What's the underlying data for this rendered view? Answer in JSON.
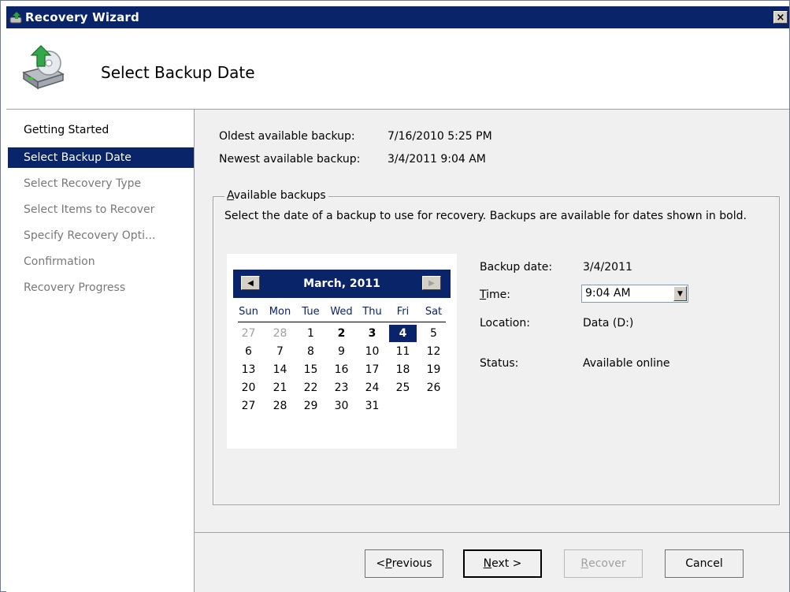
{
  "window": {
    "title": "Recovery Wizard",
    "close_glyph": "×"
  },
  "header": {
    "title": "Select Backup Date",
    "icon": "backup-recovery-icon"
  },
  "sidebar": {
    "items": [
      {
        "label": "Getting Started",
        "state": "done"
      },
      {
        "label": "Select Backup Date",
        "state": "active"
      },
      {
        "label": "Select Recovery Type",
        "state": "pending"
      },
      {
        "label": "Select Items to Recover",
        "state": "pending"
      },
      {
        "label": "Specify Recovery Opti...",
        "state": "pending"
      },
      {
        "label": "Confirmation",
        "state": "pending"
      },
      {
        "label": "Recovery Progress",
        "state": "pending"
      }
    ]
  },
  "summary": {
    "oldest_label": "Oldest available backup:",
    "oldest_value": "7/16/2010 5:25 PM",
    "newest_label": "Newest available backup:",
    "newest_value": "3/4/2011 9:04 AM"
  },
  "group": {
    "legend_accel": "A",
    "legend_rest": "vailable backups",
    "description": "Select the date of a backup to use for recovery. Backups are available for dates shown in bold."
  },
  "calendar": {
    "title": "March, 2011",
    "prev_glyph": "◀",
    "next_glyph": "▶",
    "dow": [
      "Sun",
      "Mon",
      "Tue",
      "Wed",
      "Thu",
      "Fri",
      "Sat"
    ],
    "weeks": [
      [
        {
          "d": "27",
          "other": true
        },
        {
          "d": "28",
          "other": true
        },
        {
          "d": "1"
        },
        {
          "d": "2",
          "bold": true
        },
        {
          "d": "3",
          "bold": true
        },
        {
          "d": "4",
          "sel": true
        },
        {
          "d": "5"
        }
      ],
      [
        {
          "d": "6"
        },
        {
          "d": "7"
        },
        {
          "d": "8"
        },
        {
          "d": "9"
        },
        {
          "d": "10"
        },
        {
          "d": "11"
        },
        {
          "d": "12"
        }
      ],
      [
        {
          "d": "13"
        },
        {
          "d": "14"
        },
        {
          "d": "15"
        },
        {
          "d": "16"
        },
        {
          "d": "17"
        },
        {
          "d": "18"
        },
        {
          "d": "19"
        }
      ],
      [
        {
          "d": "20"
        },
        {
          "d": "21"
        },
        {
          "d": "22"
        },
        {
          "d": "23"
        },
        {
          "d": "24"
        },
        {
          "d": "25"
        },
        {
          "d": "26"
        }
      ],
      [
        {
          "d": "27"
        },
        {
          "d": "28"
        },
        {
          "d": "29"
        },
        {
          "d": "30"
        },
        {
          "d": "31"
        }
      ]
    ]
  },
  "details": {
    "backup_date_label": "Backup date:",
    "backup_date_value": "3/4/2011",
    "time_label_accel": "T",
    "time_label_rest": "ime:",
    "time_value": "9:04 AM",
    "location_label": "Location:",
    "location_value": "Data (D:)",
    "status_label": "Status:",
    "status_value": "Available online"
  },
  "buttons": {
    "previous_pre": "< ",
    "previous_accel": "P",
    "previous_rest": "revious",
    "next_accel": "N",
    "next_rest": "ext >",
    "recover_accel": "R",
    "recover_rest": "ecover",
    "cancel": "Cancel"
  },
  "colors": {
    "accent": "#0a246a",
    "panel": "#f0f0f0",
    "disabled_text": "#787878"
  }
}
